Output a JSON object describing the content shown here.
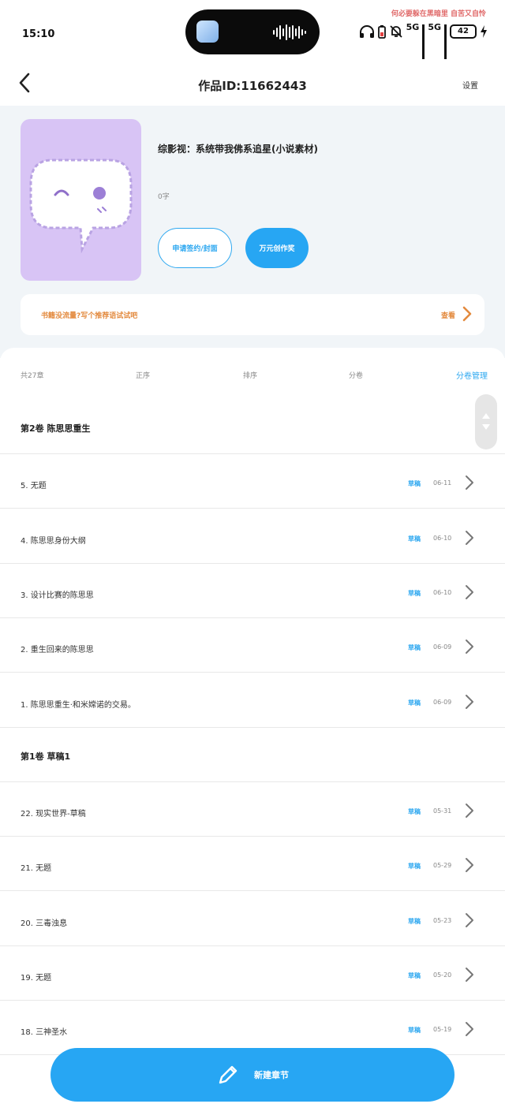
{
  "status_bar": {
    "time": "15:10",
    "notice": "何必要躲在黑暗里 自苦又自怜",
    "network_1": "5G",
    "network_2": "5G",
    "battery": "42",
    "icons": [
      "headphones-icon",
      "battery-saver-icon",
      "bell-muted-icon",
      "signal-icon",
      "signal-icon",
      "battery-icon",
      "charging-icon"
    ]
  },
  "header": {
    "back_icon": "chevron-left-icon",
    "title": "作品ID:11662443",
    "settings_label": "设置"
  },
  "book": {
    "title": "综影视：系统带我佛系追星(小说素材)",
    "word_count": "0字",
    "sign_button": "申请签约/封面",
    "award_button": "万元创作奖"
  },
  "promo": {
    "text": "书籍没流量?写个推荐语试试吧",
    "view_label": "查看"
  },
  "toolbar": {
    "count": "共27章",
    "order": "正序",
    "sort": "排序",
    "split": "分卷",
    "manage": "分卷管理"
  },
  "rows": [
    {
      "type": "volume",
      "label": "第2卷 陈思思重生"
    },
    {
      "type": "chapter",
      "title": "5. 无题",
      "status": "草稿",
      "date": "06-11"
    },
    {
      "type": "chapter",
      "title": "4. 陈思思身份大纲",
      "status": "草稿",
      "date": "06-10"
    },
    {
      "type": "chapter",
      "title": "3. 设计比赛的陈思思",
      "status": "草稿",
      "date": "06-10"
    },
    {
      "type": "chapter",
      "title": "2. 重生回来的陈思思",
      "status": "草稿",
      "date": "06-09"
    },
    {
      "type": "chapter",
      "title": "1. 陈思思重生·和米嫦诺的交易。",
      "status": "草稿",
      "date": "06-09"
    },
    {
      "type": "volume",
      "label": "第1卷 草稿1"
    },
    {
      "type": "chapter",
      "title": "22. 现实世界-草稿",
      "status": "草稿",
      "date": "05-31"
    },
    {
      "type": "chapter",
      "title": "21. 无题",
      "status": "草稿",
      "date": "05-29"
    },
    {
      "type": "chapter",
      "title": "20. 三毒浊息",
      "status": "草稿",
      "date": "05-23"
    },
    {
      "type": "chapter",
      "title": "19. 无题",
      "status": "草稿",
      "date": "05-20"
    },
    {
      "type": "chapter",
      "title": "18. 三神圣水",
      "status": "草稿",
      "date": "05-19"
    }
  ],
  "new_chapter": {
    "label": "新建章节",
    "icon": "pencil-icon"
  },
  "colors": {
    "accent": "#27a6f3",
    "promo": "#e38a3e",
    "cover": "#d8c4f5",
    "hero_bg": "#f1f5f8"
  }
}
